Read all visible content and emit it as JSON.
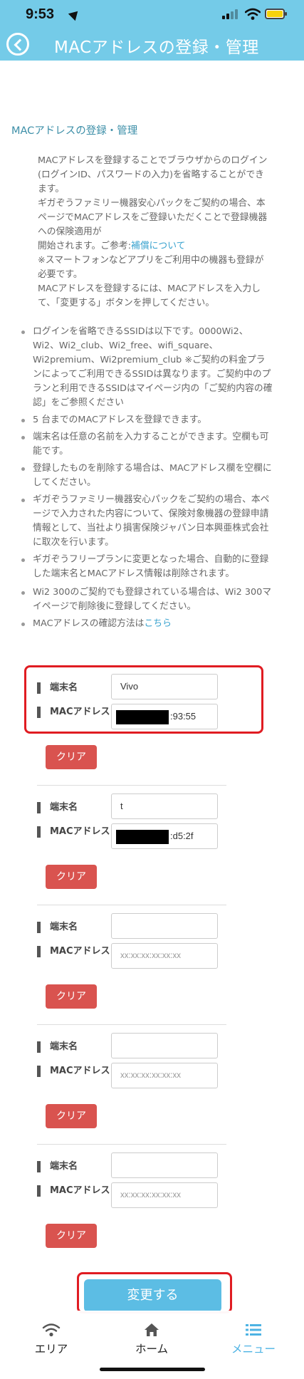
{
  "status_bar": {
    "time": "9:53"
  },
  "header": {
    "title": "MACアドレスの登録・管理"
  },
  "section": {
    "title": "MACアドレスの登録・管理",
    "intro": [
      "MACアドレスを登録することでブラウザからのログイン(ログインID、パスワードの入力)を省略することができます。",
      "ギガぞうファミリー機器安心パックをご契約の場合、本ページでMACアドレスをご登録いただくことで登録機器への保険適用が",
      "開始されます。ご参考:",
      "補償について",
      "※スマートフォンなどアプリをご利用中の機器も登録が必要です。",
      "MACアドレスを登録するには、MACアドレスを入力して、「変更する」ボタンを押してください。"
    ],
    "notes": [
      "ログインを省略できるSSIDは以下です。0000Wi2、Wi2、Wi2_club、Wi2_free、wifi_square、Wi2premium、Wi2premium_club ※ご契約の料金プランによってご利用できるSSIDは異なります。ご契約中のプランと利用できるSSIDはマイページ内の「ご契約内容の確認」をご参照ください",
      "5 台までのMACアドレスを登録できます。",
      "端末名は任意の名前を入力することができます。空欄も可能です。",
      "登録したものを削除する場合は、MACアドレス欄を空欄にしてください。",
      "ギガぞうファミリー機器安心パックをご契約の場合、本ページで入力された内容について、保険対象機器の登録申請情報として、当社より損害保険ジャパン日本興亜株式会社に取次を行います。",
      "ギガぞうフリープランに変更となった場合、自動的に登録した端末名とMACアドレス情報は削除されます。",
      "Wi2 300のご契約でも登録されている場合は、Wi2 300マイページで削除後に登録してください。",
      "MACアドレスの確認方法は",
      "こちら"
    ]
  },
  "form": {
    "name_label": "端末名",
    "mac_label": "MACアドレス",
    "clear_label": "クリア",
    "mac_placeholder": "xx:xx:xx:xx:xx:xx",
    "devices": [
      {
        "name": "Vivo",
        "mac_visible_suffix": ":93:55"
      },
      {
        "name": "t",
        "mac_visible_suffix": ":d5:2f"
      },
      {
        "name": "",
        "mac_visible_suffix": ""
      },
      {
        "name": "",
        "mac_visible_suffix": ""
      },
      {
        "name": "",
        "mac_visible_suffix": ""
      }
    ],
    "submit_label": "変更する"
  },
  "tabbar": {
    "items": [
      {
        "label": "エリア",
        "icon": "wifi-icon"
      },
      {
        "label": "ホーム",
        "icon": "home-icon"
      },
      {
        "label": "メニュー",
        "icon": "menu-list-icon",
        "active": true
      }
    ]
  },
  "colors": {
    "header": "#74cbe8",
    "accent": "#4db3e4",
    "clear_button": "#d9534f",
    "highlight": "#e01c22"
  }
}
